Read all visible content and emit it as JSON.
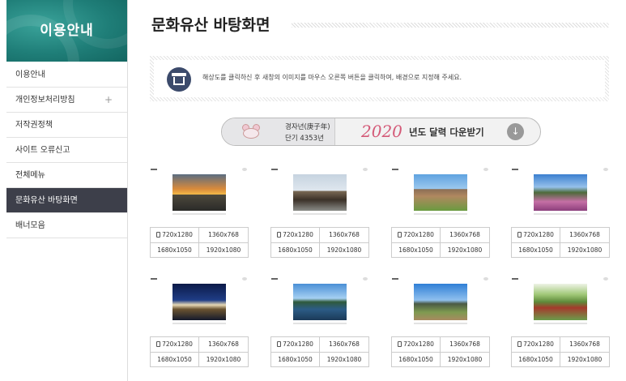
{
  "sidebar": {
    "title": "이용안내",
    "items": [
      {
        "label": "이용안내",
        "plus": ""
      },
      {
        "label": "개인정보처리방침",
        "plus": "+"
      },
      {
        "label": "저작권정책",
        "plus": ""
      },
      {
        "label": "사이트 오류신고",
        "plus": ""
      },
      {
        "label": "전체메뉴",
        "plus": ""
      },
      {
        "label": "문화유산 바탕화면",
        "plus": "",
        "active": true
      },
      {
        "label": "배너모음",
        "plus": ""
      }
    ]
  },
  "main": {
    "title": "문화유산 바탕화면",
    "notice": "해상도를 클릭하신 후 새창의 이미지를 마우스 오른쪽 버튼을 클릭하여, 배경으로 지정해 주세요.",
    "banner": {
      "year_line1": "경자년(庚子年)",
      "year_line2": "단기 4353년",
      "year": "2020",
      "text": "년도 달력 다운받기"
    },
    "wallpapers": [
      {
        "id": "wp1",
        "resolutions": [
          "720x1280",
          "1360x768",
          "1680x1050",
          "1920x1080"
        ]
      },
      {
        "id": "wp2",
        "resolutions": [
          "720x1280",
          "1360x768",
          "1680x1050",
          "1920x1080"
        ]
      },
      {
        "id": "wp3",
        "resolutions": [
          "720x1280",
          "1360x768",
          "1680x1050",
          "1920x1080"
        ]
      },
      {
        "id": "wp4",
        "resolutions": [
          "720x1280",
          "1360x768",
          "1680x1050",
          "1920x1080"
        ]
      },
      {
        "id": "wp5",
        "resolutions": [
          "720x1280",
          "1360x768",
          "1680x1050",
          "1920x1080"
        ]
      },
      {
        "id": "wp6",
        "resolutions": [
          "720x1280",
          "1360x768",
          "1680x1050",
          "1920x1080"
        ]
      },
      {
        "id": "wp7",
        "resolutions": [
          "720x1280",
          "1360x768",
          "1680x1050",
          "1920x1080"
        ]
      },
      {
        "id": "wp8",
        "resolutions": [
          "720x1280",
          "1360x768",
          "1680x1050",
          "1920x1080"
        ]
      }
    ]
  },
  "colors": {
    "sidebar_header": "#1f7e78",
    "active_item": "#3d3f4a",
    "banner_year": "#d45a78"
  },
  "icons": {
    "notice": "heritage-house-icon",
    "download": "download-arrow-icon",
    "phone": "mobile-phone-icon",
    "mascot": "mouse-mascot-icon"
  }
}
